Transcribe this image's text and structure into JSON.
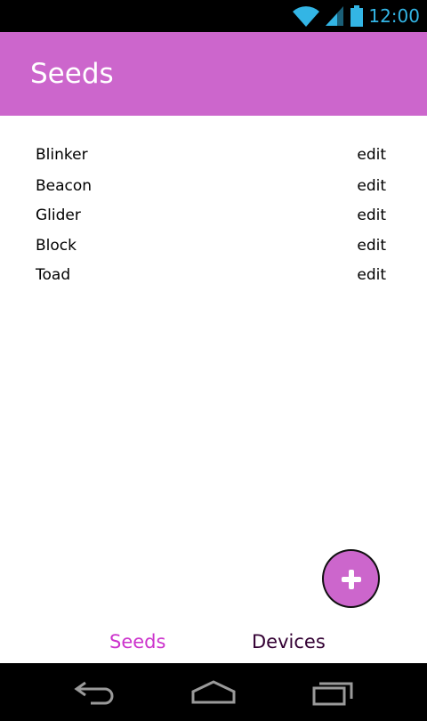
{
  "status_bar": {
    "time": "12:00",
    "icons": [
      "wifi-icon",
      "signal-icon",
      "battery-icon"
    ],
    "icon_color": "#33b5e5"
  },
  "app_bar": {
    "title": "Seeds",
    "color": "#cc66cc"
  },
  "seeds": [
    {
      "name": "Blinker",
      "action": "edit"
    },
    {
      "name": "Beacon",
      "action": "edit"
    },
    {
      "name": "Glider",
      "action": "edit"
    },
    {
      "name": "Block",
      "action": "edit"
    },
    {
      "name": "Toad",
      "action": "edit"
    }
  ],
  "fab": {
    "icon": "plus-icon",
    "color": "#cc66cc"
  },
  "tabs": [
    {
      "label": "Seeds",
      "active": true,
      "color": "#cc33cc"
    },
    {
      "label": "Devices",
      "active": false,
      "color": "#330033"
    }
  ],
  "nav_bar": {
    "icons": [
      "back-icon",
      "home-icon",
      "recents-icon"
    ]
  }
}
